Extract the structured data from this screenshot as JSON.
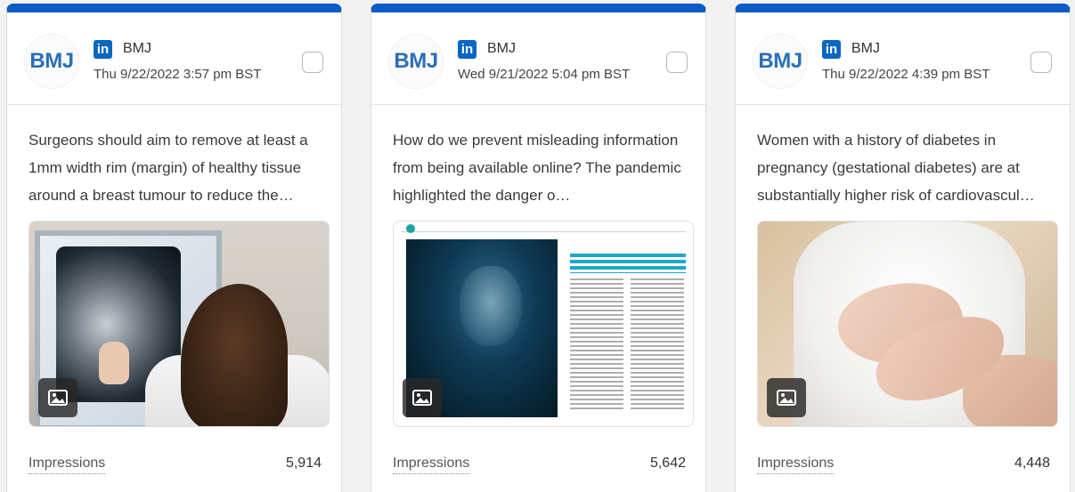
{
  "colors": {
    "accent": "#0b5cc6",
    "linkedin": "#0a66c2",
    "bmj_blue": "#2a6fb6"
  },
  "posts": [
    {
      "avatar_text": "BMJ",
      "network_icon": "linkedin-icon",
      "network_icon_text": "in",
      "author": "BMJ",
      "timestamp": "Thu 9/22/2022 3:57 pm BST",
      "text": "Surgeons should aim to remove at least a 1mm width rim (margin) of healthy tissue around a breast tumour to reduce the…",
      "media_icon": "image-icon",
      "metric_label": "Impressions",
      "metric_value": "5,914"
    },
    {
      "avatar_text": "BMJ",
      "network_icon": "linkedin-icon",
      "network_icon_text": "in",
      "author": "BMJ",
      "timestamp": "Wed 9/21/2022 5:04 pm BST",
      "text": "How do we prevent misleading information from being available online? The pandemic highlighted the danger o…",
      "media_icon": "image-icon",
      "metric_label": "Impressions",
      "metric_value": "5,642"
    },
    {
      "avatar_text": "BMJ",
      "network_icon": "linkedin-icon",
      "network_icon_text": "in",
      "author": "BMJ",
      "timestamp": "Thu 9/22/2022 4:39 pm BST",
      "text": "Women with a history of diabetes in pregnancy (gestational diabetes) are at substantially higher risk of cardiovascul…",
      "media_icon": "image-icon",
      "metric_label": "Impressions",
      "metric_value": "4,448"
    }
  ]
}
